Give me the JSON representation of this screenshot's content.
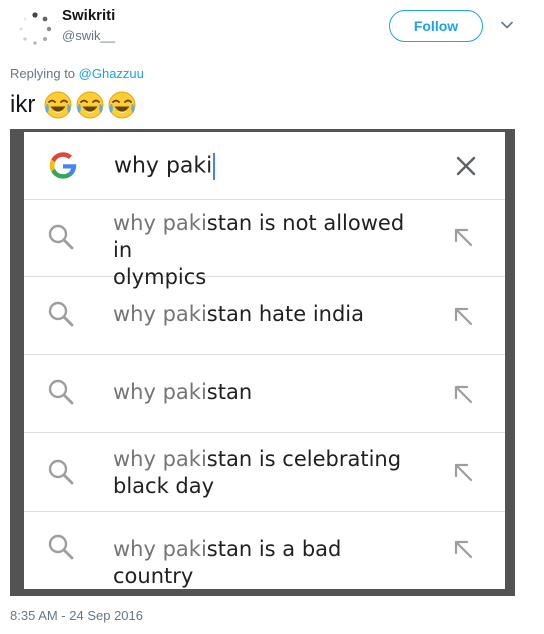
{
  "author": {
    "display_name": "Swikriti",
    "handle": "@swik__",
    "avatar_icon": "loading-spinner-icon"
  },
  "follow_label": "Follow",
  "reply": {
    "prefix": "Replying to ",
    "mention": "@Ghazzuu"
  },
  "tweet": {
    "text": "ikr",
    "emoji_icon": "face-with-tears-of-joy-icon",
    "emoji_count": 3
  },
  "screenshot": {
    "query": "why paki",
    "suggestions": [
      {
        "typed": "why paki",
        "rest_line1": "stan is not allowed in",
        "rest_line2": "olympics"
      },
      {
        "typed": "why paki",
        "rest_line1": "stan hate india",
        "rest_line2": ""
      },
      {
        "typed": "why paki",
        "rest_line1": "stan",
        "rest_line2": ""
      },
      {
        "typed": "why paki",
        "rest_line1": "stan is celebrating",
        "rest_line2": "black day"
      },
      {
        "typed": "why paki",
        "rest_line1": "stan is a bad country",
        "rest_line2": ""
      }
    ]
  },
  "timestamp": "8:35 AM - 24 Sep 2016",
  "colors": {
    "accent": "#1da1f2",
    "muted": "#657786",
    "screenshot_frame": "#535353"
  }
}
